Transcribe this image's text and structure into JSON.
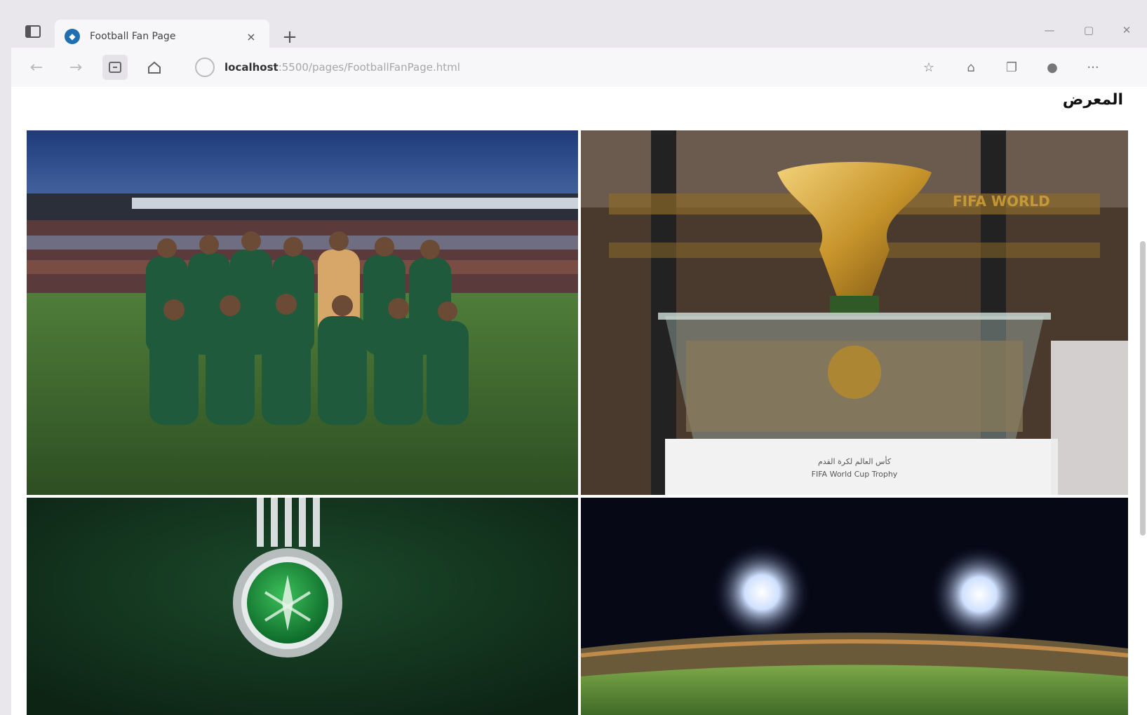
{
  "browser": {
    "tab_title": "Football Fan Page",
    "tab_close": "×",
    "new_tab": "+",
    "url_host": "localhost",
    "url_path": ":5500/pages/FootballFanPage.html",
    "more": "···"
  },
  "page": {
    "heading": "المعرض"
  },
  "gallery": {
    "items": [
      {
        "name": "team-photo",
        "icon": "team-photo"
      },
      {
        "name": "world-cup-trophy",
        "icon": "trophy",
        "caption_line1": "كأس العالم لكرة القدم",
        "caption_line2": "FIFA World Cup Trophy"
      },
      {
        "name": "federation-logo",
        "icon": "emblem"
      },
      {
        "name": "stadium-night",
        "icon": "stadium"
      }
    ],
    "trophy_banner_text": "FIFA WORLD"
  }
}
